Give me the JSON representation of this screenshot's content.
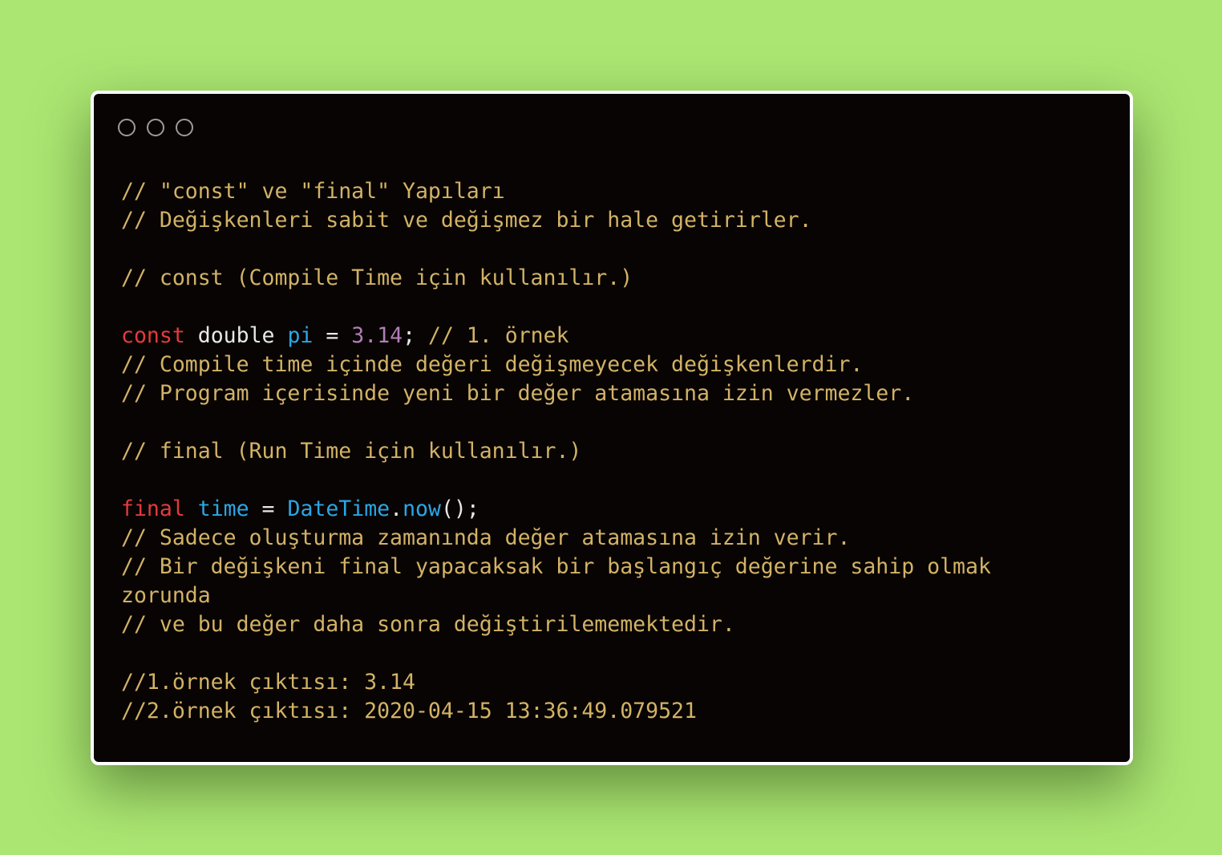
{
  "window": {
    "controls": [
      "close",
      "minimize",
      "maximize"
    ]
  },
  "code": {
    "l1": "// \"const\" ve \"final\" Yapıları",
    "l2": "// Değişkenleri sabit ve değişmez bir hale getirirler.",
    "l4": "// const (Compile Time için kullanılır.)",
    "l6_kw": "const",
    "l6_type": "double",
    "l6_id": "pi",
    "l6_eq": "=",
    "l6_num": "3.14",
    "l6_semi": ";",
    "l6_comment": "// 1. örnek",
    "l7": "// Compile time içinde değeri değişmeyecek değişkenlerdir.",
    "l8": "// Program içerisinde yeni bir değer atamasına izin vermezler.",
    "l10": "// final (Run Time için kullanılır.)",
    "l12_kw": "final",
    "l12_id": "time",
    "l12_eq": "=",
    "l12_class": "DateTime",
    "l12_dot": ".",
    "l12_method": "now",
    "l12_tail": "();",
    "l13": "// Sadece oluşturma zamanında değer atamasına izin verir.",
    "l14": "// Bir değişkeni final yapacaksak bir başlangıç değerine sahip olmak",
    "l15": "zorunda",
    "l16": "// ve bu değer daha sonra değiştirilememektedir.",
    "l18": "//1.örnek çıktısı: 3.14",
    "l19": "//2.örnek çıktısı: 2020-04-15 13:36:49.079521"
  },
  "colors": {
    "background": "#abe672",
    "window": "#080403",
    "comment": "#d2b266",
    "keyword": "#e33b3b",
    "identifier": "#2aa7e6",
    "number": "#b07eb6",
    "plain": "#e8e8e8"
  }
}
